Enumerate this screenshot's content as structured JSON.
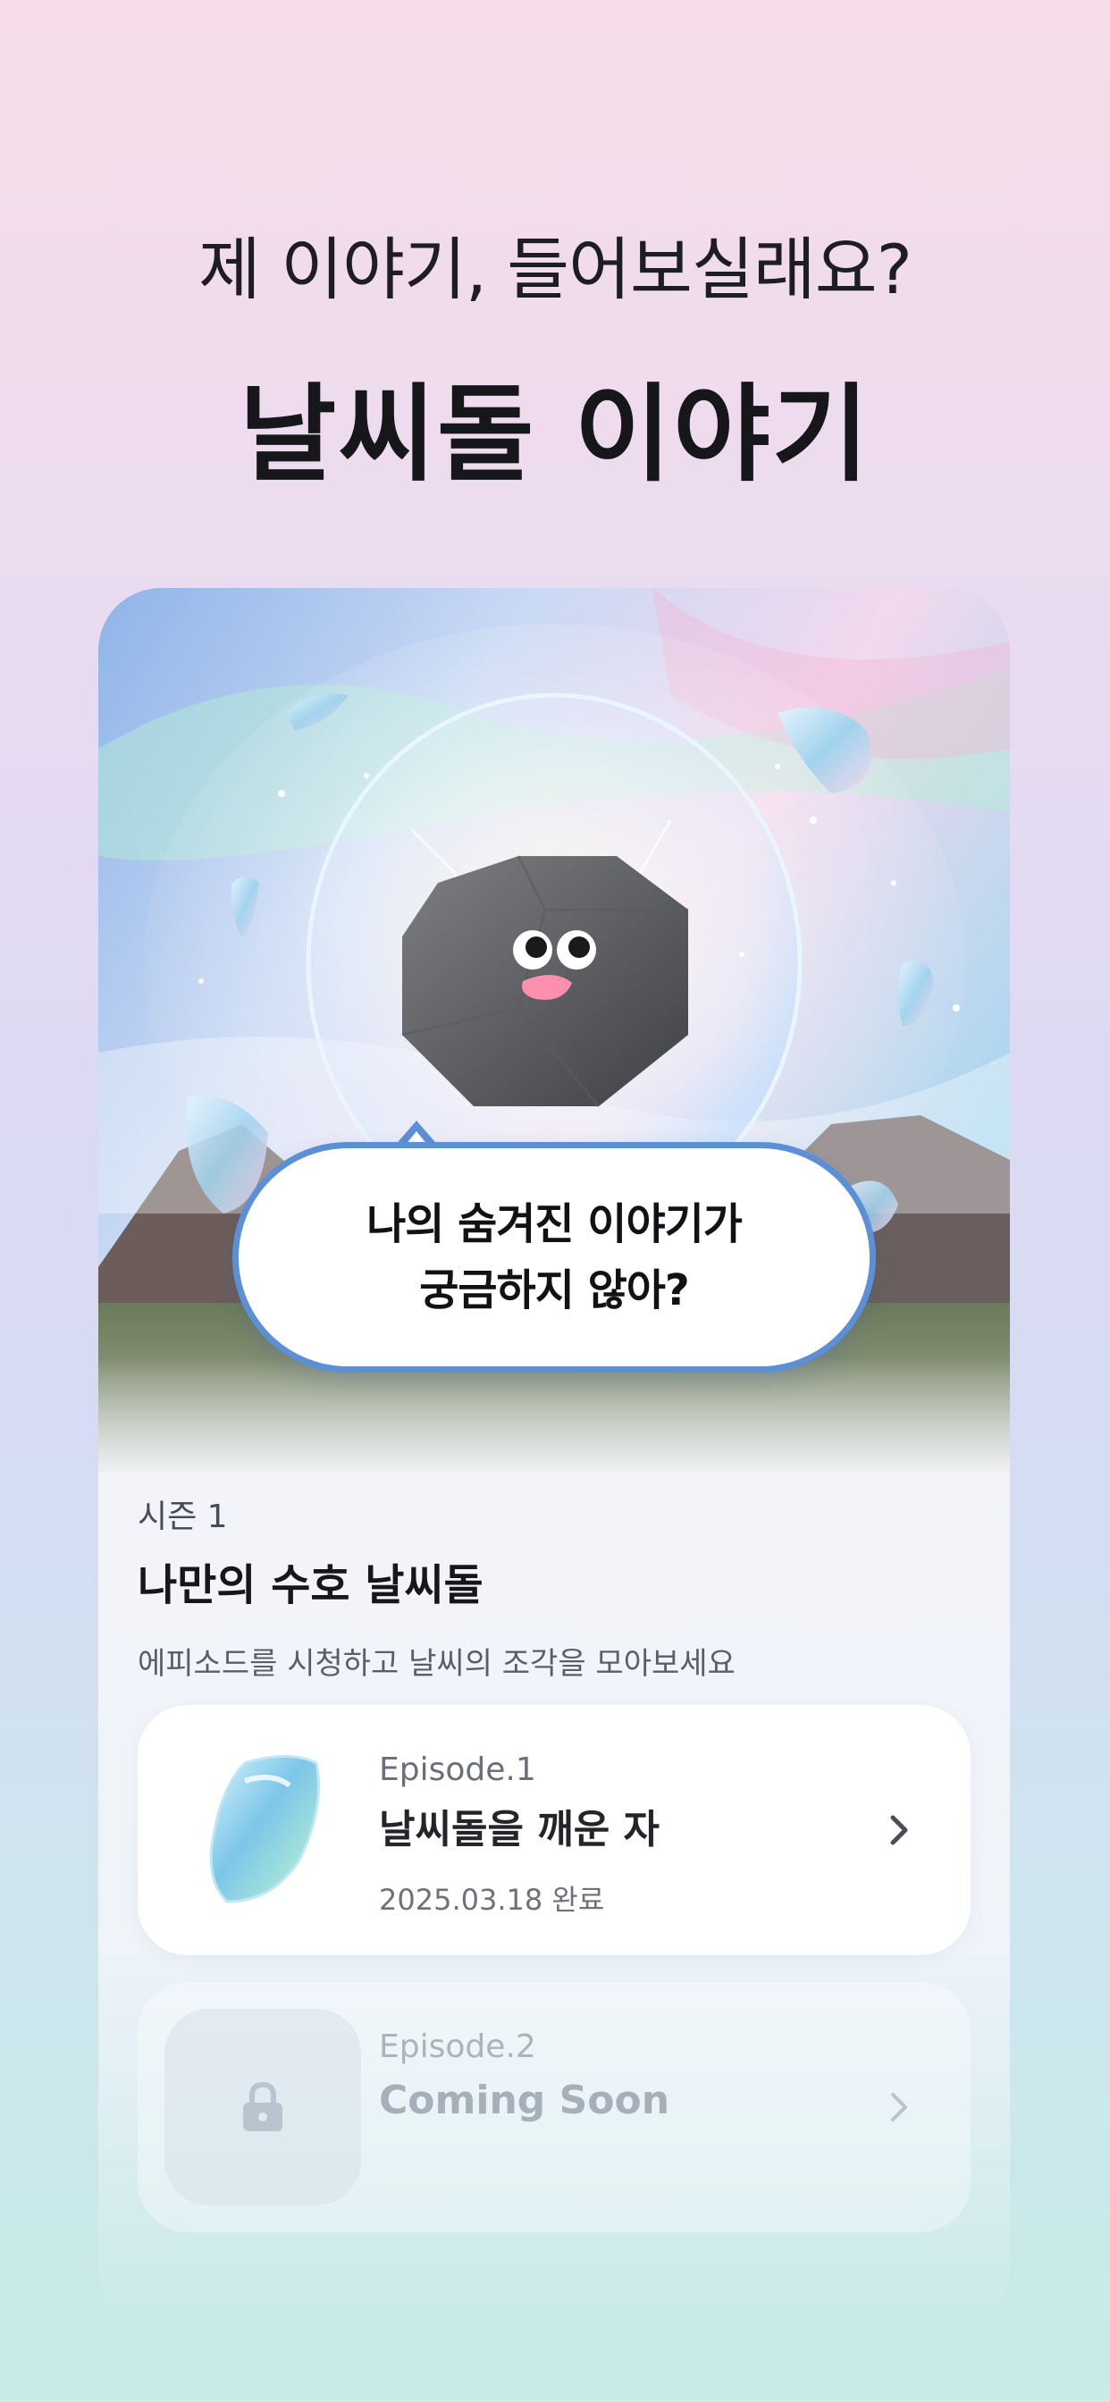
{
  "header": {
    "subtitle": "제 이야기, 들어보실래요?",
    "title": "날씨돌 이야기"
  },
  "hero": {
    "speech_bubble": {
      "line1": "나의 숨겨진 이야기가",
      "line2": "궁금하지 않아?"
    }
  },
  "season": {
    "label": "시즌 1",
    "title": "나만의 수호 날씨돌",
    "description": "에피소드를 시청하고 날씨의 조각을 모아보세요"
  },
  "episodes": [
    {
      "number": "Episode.1",
      "title": "날씨돌을 깨운 자",
      "date": "2025.03.18 완료",
      "icon": "crystal-icon",
      "locked": false
    },
    {
      "number": "Episode.2",
      "title": "Coming Soon",
      "icon": "lock-icon",
      "locked": true
    }
  ],
  "colors": {
    "bubble_border": "#5b8fd6",
    "title_text": "#16171b",
    "locked_text": "#a6b0bb"
  }
}
